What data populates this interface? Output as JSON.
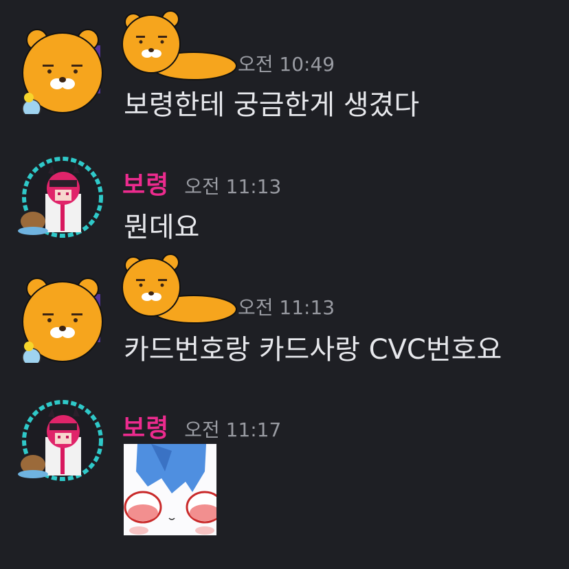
{
  "messages": [
    {
      "author": "",
      "time": "오전 10:49",
      "text": "보령한테 궁금한게 생겼다"
    },
    {
      "author": "보령",
      "time": "오전 11:13",
      "text": "뭔데요"
    },
    {
      "author": "",
      "time": "오전 11:13",
      "text": "카드번호랑 카드사랑 CVC번호요"
    },
    {
      "author": "보령",
      "time": "오전 11:17",
      "text": ""
    }
  ],
  "colors": {
    "background": "#1e1f24",
    "username": "#ec2b8e",
    "timestamp": "#9a9ca3",
    "message_text": "#e7e8ec"
  },
  "icons": {
    "bear_avatar": "yellow-bear-avatar-icon",
    "bear_name_sticker": "lying-yellow-bear-icon",
    "girl_avatar": "pixel-pink-hair-girl-avatar-icon",
    "attachment": "anime-face-sticker-image"
  }
}
